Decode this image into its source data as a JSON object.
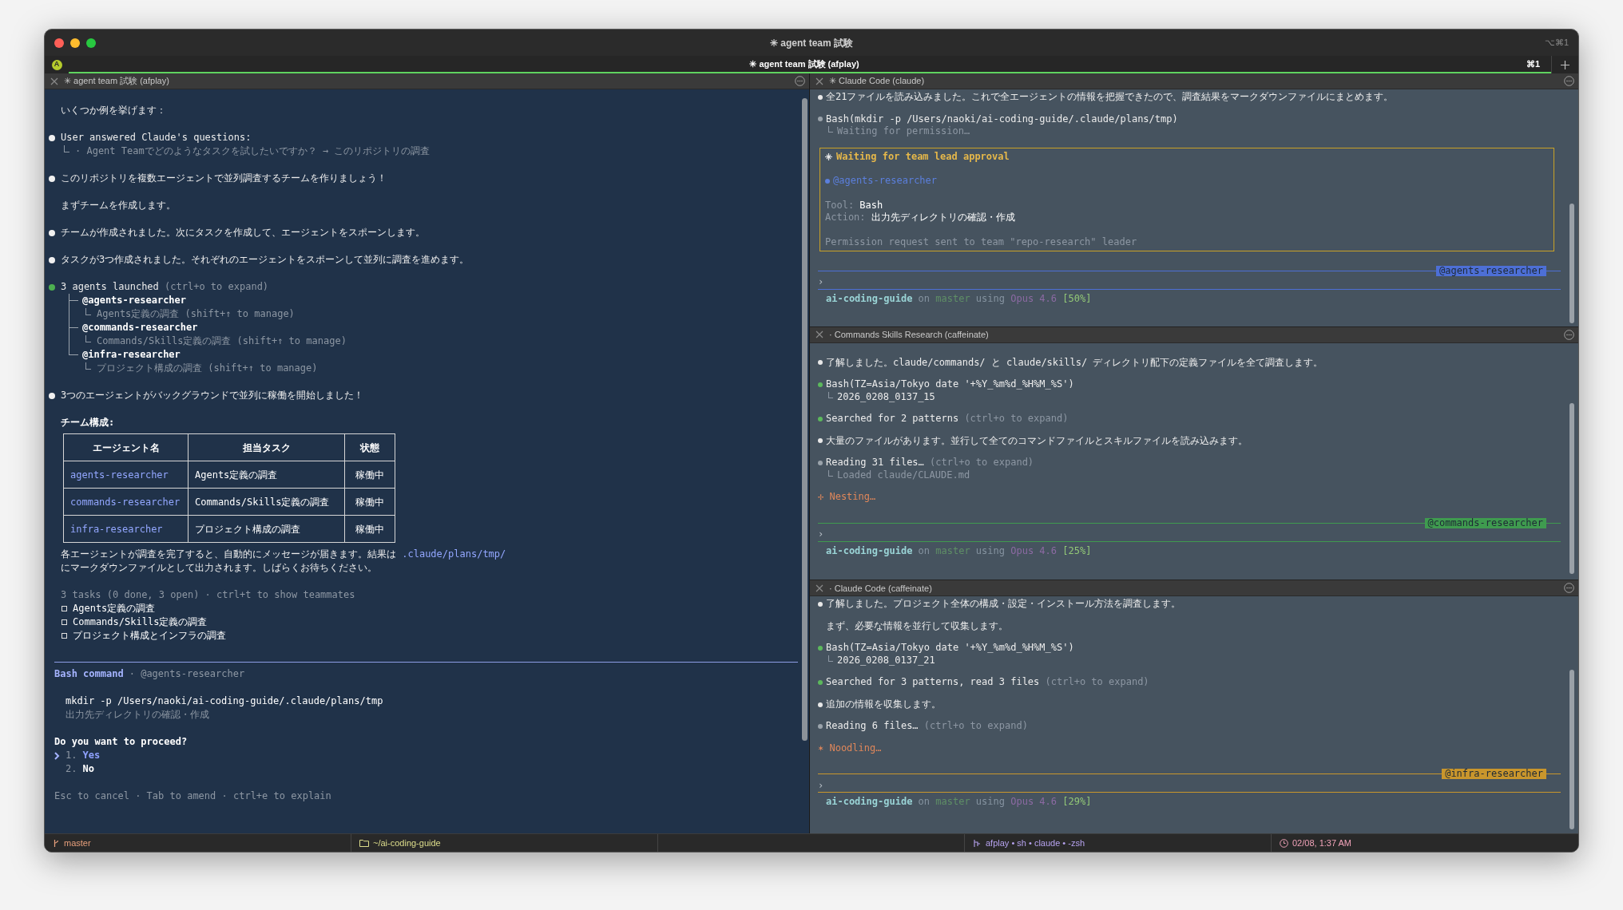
{
  "window": {
    "title": "✳ agent team 試験",
    "shortcut": "⌥⌘1"
  },
  "tab_bar": {
    "badge": "A",
    "tabs": [
      {
        "label": "✳ agent team 試験 (afplay)",
        "shortcut": "⌘1",
        "selected": true
      }
    ]
  },
  "main_pane": {
    "title": "✳ agent team 試験 (afplay)",
    "blocks": [
      {
        "kind": "lines",
        "lines": [
          {
            "kind": "note",
            "segments": [
              {
                "text": "いくつか例を挙げます：",
                "kind": "plain"
              }
            ]
          }
        ]
      },
      {
        "kind": "lines",
        "lines": [
          {
            "kind": "message",
            "color": "#f0f0f0",
            "segments": [
              {
                "text": "User answered Claude's questions:",
                "kind": "plain"
              }
            ]
          },
          {
            "kind": "detail",
            "segments": [
              {
                "text": "· Agent Teamでどのようなタスクを試したいですか？ → このリポジトリの調査",
                "kind": "dim"
              }
            ]
          }
        ]
      },
      {
        "kind": "lines",
        "lines": [
          {
            "kind": "message",
            "color": "#f0f0f0",
            "segments": [
              {
                "text": "このリポジトリを複数エージェントで並列調査するチームを作りましょう！",
                "kind": "plain"
              }
            ]
          }
        ]
      },
      {
        "kind": "lines",
        "lines": [
          {
            "kind": "note",
            "segments": [
              {
                "text": "まずチームを作成します。",
                "kind": "plain"
              }
            ]
          }
        ]
      },
      {
        "kind": "lines",
        "lines": [
          {
            "kind": "message",
            "color": "#f0f0f0",
            "segments": [
              {
                "text": "チームが作成されました。次にタスクを作成して、エージェントをスポーンします。",
                "kind": "plain"
              }
            ]
          }
        ]
      },
      {
        "kind": "lines",
        "lines": [
          {
            "kind": "message",
            "color": "#f0f0f0",
            "segments": [
              {
                "text": "タスクが3つ作成されました。それぞれのエージェントをスポーンして並列に調査を進めます。",
                "kind": "plain"
              }
            ]
          }
        ]
      },
      {
        "kind": "tree",
        "color": "#4caf50",
        "segments": [
          {
            "text": "3 agents launched",
            "kind": "plain"
          },
          {
            "text": " (ctrl+o to expand)",
            "kind": "dim"
          }
        ],
        "children": [
          {
            "text": "@agents-researcher",
            "children": [
              {
                "text": "Agents定義の調査 (shift+↑ to manage)"
              }
            ]
          },
          {
            "text": "@commands-researcher",
            "children": [
              {
                "text": "Commands/Skills定義の調査 (shift+↑ to manage)"
              }
            ]
          },
          {
            "text": "@infra-researcher",
            "children": [
              {
                "text": "プロジェクト構成の調査 (shift+↑ to manage)"
              }
            ]
          }
        ]
      },
      {
        "kind": "lines",
        "lines": [
          {
            "kind": "message",
            "color": "#f0f0f0",
            "segments": [
              {
                "text": "3つのエージェントがバックグラウンドで並列に稼働を開始しました！",
                "kind": "plain"
              }
            ]
          }
        ]
      },
      {
        "kind": "table",
        "caption": "チーム構成:",
        "columns": [
          "エージェント名",
          "担当タスク",
          "状態"
        ],
        "rows": [
          {
            "agent": "agents-researcher",
            "task": "Agents定義の調査",
            "status": "稼働中"
          },
          {
            "agent": "commands-researcher",
            "task": "Commands/Skills定義の調査",
            "status": "稼働中"
          },
          {
            "agent": "infra-researcher",
            "task": "プロジェクト構成の調査",
            "status": "稼働中"
          }
        ],
        "after": [
          {
            "kind": "note",
            "segments": [
              {
                "text": "各エージェントが調査を完了すると、自動的にメッセージが届きます。結果は ",
                "kind": "plain"
              },
              {
                "text": ".claude/plans/tmp/",
                "kind": "link"
              }
            ]
          },
          {
            "kind": "note",
            "segments": [
              {
                "text": "にマークダウンファイルとして出力されます。しばらくお待ちください。",
                "kind": "plain"
              }
            ]
          }
        ]
      },
      {
        "kind": "tasks",
        "summary": "3 tasks (0 done, 3 open) · ctrl+t to show teammates",
        "items": [
          {
            "text": "Agents定義の調査",
            "checked": false
          },
          {
            "text": "Commands/Skills定義の調査",
            "checked": false
          },
          {
            "text": "プロジェクト構成とインフラの調査",
            "checked": false
          }
        ]
      }
    ],
    "prompt": {
      "title": "Bash command",
      "agent": "· @agents-researcher",
      "command": "mkdir -p /Users/naoki/ai-coding-guide/.claude/plans/tmp",
      "description": "出力先ディレクトリの確認・作成",
      "question": "Do you want to proceed?",
      "options": [
        {
          "number": "1.",
          "label": "Yes",
          "selected": true
        },
        {
          "number": "2.",
          "label": "No",
          "selected": false
        }
      ],
      "hint": "Esc to cancel · Tab to amend · ctrl+e to explain"
    }
  },
  "side_panes": [
    {
      "title": "✳ Claude Code (claude)",
      "blocks": [
        {
          "kind": "lines",
          "lines": [
            {
              "kind": "message",
              "color": "#e8e8e8",
              "segments": [
                {
                  "text": "全21ファイルを読み込みました。これで全エージェントの情報を把握できたので、調査結果をマークダウンファイルにまとめます。",
                  "kind": "plain"
                }
              ]
            }
          ]
        },
        {
          "kind": "lines",
          "lines": [
            {
              "kind": "message",
              "color": "#9aa3ab",
              "segments": [
                {
                  "text": "Bash(mkdir -p /Users/naoki/ai-coding-guide/.claude/plans/tmp)",
                  "kind": "plain"
                }
              ]
            },
            {
              "kind": "detail",
              "segments": [
                {
                  "text": "Waiting for permission…",
                  "kind": "dim"
                }
              ]
            }
          ]
        },
        {
          "kind": "approval",
          "title": "Waiting for team lead approval",
          "agent": {
            "text": "@agents-researcher",
            "color": "#5b7fdc"
          },
          "fields": [
            {
              "label": "Tool:",
              "value": "Bash"
            },
            {
              "label": "Action:",
              "value": "出力先ディレクトリの確認・作成"
            }
          ],
          "footer": "Permission request sent to team \"repo-research\" leader"
        }
      ],
      "teammate": {
        "label": "@agents-researcher",
        "color": "#4d6fd6"
      },
      "prompt": "›",
      "status": [
        {
          "text": "ai-coding-guide",
          "kind": "repo"
        },
        {
          "text": " on ",
          "kind": "muted"
        },
        {
          "text": "master",
          "kind": "branch"
        },
        {
          "text": " using ",
          "kind": "muted"
        },
        {
          "text": "Opus 4.6",
          "kind": "model"
        },
        {
          "text": " [50%]",
          "kind": "context"
        }
      ]
    },
    {
      "title": "· Commands Skills Research (caffeinate)",
      "blocks": [
        {
          "kind": "lines",
          "lines": [
            {
              "kind": "message",
              "color": "#e8e8e8",
              "segments": [
                {
                  "text": "了解しました。claude/commands/ と claude/skills/ ディレクトリ配下の定義ファイルを全て調査します。",
                  "kind": "plain"
                }
              ]
            }
          ]
        },
        {
          "kind": "lines",
          "lines": [
            {
              "kind": "message",
              "color": "#5cb85c",
              "segments": [
                {
                  "text": "Bash(TZ=Asia/Tokyo date '+%Y_%m%d_%H%M_%S')",
                  "kind": "plain"
                }
              ]
            },
            {
              "kind": "detail",
              "segments": [
                {
                  "text": "2026_0208_0137_15",
                  "kind": "plain"
                }
              ]
            }
          ]
        },
        {
          "kind": "lines",
          "lines": [
            {
              "kind": "message",
              "color": "#5cb85c",
              "segments": [
                {
                  "text": "Searched for 2 patterns",
                  "kind": "plain"
                },
                {
                  "text": " (ctrl+o to expand)",
                  "kind": "dim"
                }
              ]
            }
          ]
        },
        {
          "kind": "lines",
          "lines": [
            {
              "kind": "message",
              "color": "#e8e8e8",
              "segments": [
                {
                  "text": "大量のファイルがあります。並行して全てのコマンドファイルとスキルファイルを読み込みます。",
                  "kind": "plain"
                }
              ]
            }
          ]
        },
        {
          "kind": "lines",
          "lines": [
            {
              "kind": "message",
              "color": "#9aa3ab",
              "segments": [
                {
                  "text": "Reading 31 files…",
                  "kind": "plain"
                },
                {
                  "text": " (ctrl+o to expand)",
                  "kind": "dim"
                }
              ]
            },
            {
              "kind": "detail",
              "segments": [
                {
                  "text": "Loaded claude/CLAUDE.md",
                  "kind": "dim"
                }
              ]
            }
          ]
        },
        {
          "kind": "lines",
          "lines": [
            {
              "kind": "spinner",
              "segments": [
                {
                  "text": "✢ Nesting…",
                  "kind": "spin"
                }
              ]
            }
          ]
        }
      ],
      "teammate": {
        "label": "@commands-researcher",
        "color": "#3f9b4f"
      },
      "prompt": "›",
      "status": [
        {
          "text": "ai-coding-guide",
          "kind": "repo"
        },
        {
          "text": " on ",
          "kind": "muted"
        },
        {
          "text": "master",
          "kind": "branch"
        },
        {
          "text": " using ",
          "kind": "muted"
        },
        {
          "text": "Opus 4.6",
          "kind": "model"
        },
        {
          "text": " [25%]",
          "kind": "context"
        }
      ]
    },
    {
      "title": "· Claude Code (caffeinate)",
      "blocks": [
        {
          "kind": "lines",
          "lines": [
            {
              "kind": "message",
              "color": "#e8e8e8",
              "segments": [
                {
                  "text": "了解しました。プロジェクト全体の構成・設定・インストール方法を調査します。",
                  "kind": "plain"
                }
              ]
            }
          ]
        },
        {
          "kind": "lines",
          "lines": [
            {
              "kind": "note",
              "segments": [
                {
                  "text": "まず、必要な情報を並行して収集します。",
                  "kind": "plain"
                }
              ]
            }
          ]
        },
        {
          "kind": "lines",
          "lines": [
            {
              "kind": "message",
              "color": "#5cb85c",
              "segments": [
                {
                  "text": "Bash(TZ=Asia/Tokyo date '+%Y_%m%d_%H%M_%S')",
                  "kind": "plain"
                }
              ]
            },
            {
              "kind": "detail",
              "segments": [
                {
                  "text": "2026_0208_0137_21",
                  "kind": "plain"
                }
              ]
            }
          ]
        },
        {
          "kind": "lines",
          "lines": [
            {
              "kind": "message",
              "color": "#5cb85c",
              "segments": [
                {
                  "text": "Searched for 3 patterns, read 3 files",
                  "kind": "plain"
                },
                {
                  "text": " (ctrl+o to expand)",
                  "kind": "dim"
                }
              ]
            }
          ]
        },
        {
          "kind": "lines",
          "lines": [
            {
              "kind": "message",
              "color": "#e8e8e8",
              "segments": [
                {
                  "text": "追加の情報を収集します。",
                  "kind": "plain"
                }
              ]
            }
          ]
        },
        {
          "kind": "lines",
          "lines": [
            {
              "kind": "message",
              "color": "#9aa3ab",
              "segments": [
                {
                  "text": "Reading 6 files…",
                  "kind": "plain"
                },
                {
                  "text": " (ctrl+o to expand)",
                  "kind": "dim"
                }
              ]
            }
          ]
        },
        {
          "kind": "lines",
          "lines": [
            {
              "kind": "spinner",
              "segments": [
                {
                  "text": "✶ Noodling…",
                  "kind": "spin"
                }
              ]
            }
          ]
        }
      ],
      "teammate": {
        "label": "@infra-researcher",
        "color": "#c9962c"
      },
      "prompt": "›",
      "status": [
        {
          "text": "ai-coding-guide",
          "kind": "repo"
        },
        {
          "text": " on ",
          "kind": "muted"
        },
        {
          "text": "master",
          "kind": "branch"
        },
        {
          "text": " using ",
          "kind": "muted"
        },
        {
          "text": "Opus 4.6",
          "kind": "model"
        },
        {
          "text": " [29%]",
          "kind": "context"
        }
      ]
    }
  ],
  "status_bar": {
    "items": [
      {
        "kind": "branch",
        "text": "master"
      },
      {
        "kind": "folder",
        "text": "~/ai-coding-guide"
      },
      {
        "kind": "process",
        "text": "afplay • sh • claude • -zsh"
      },
      {
        "kind": "clock",
        "text": "02/08, 1:37 AM"
      }
    ]
  }
}
